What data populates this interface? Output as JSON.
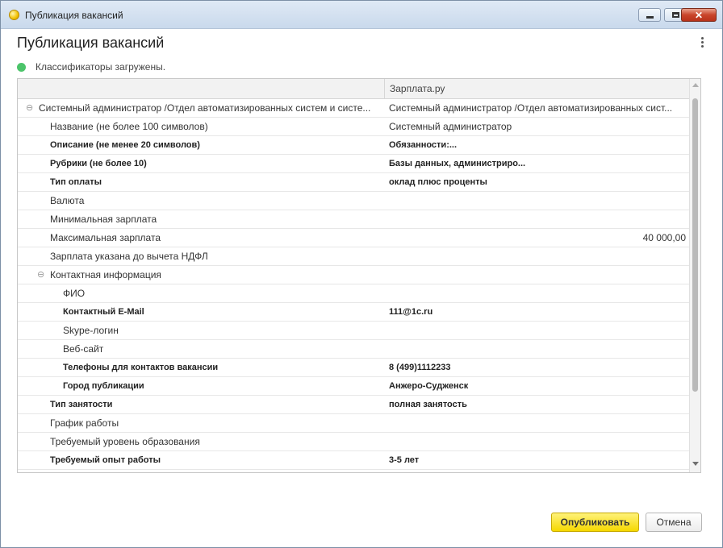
{
  "window": {
    "title": "Публикация вакансий"
  },
  "form": {
    "title": "Публикация вакансий",
    "status_text": "Классификаторы загружены.",
    "status_color": "#4cc46a"
  },
  "grid": {
    "header_col1": "",
    "header_col2": "Зарплата.ру",
    "rows": [
      {
        "label": "Системный администратор /Отдел автоматизированных систем и систе...",
        "value": "Системный администратор /Отдел автоматизированных сист...",
        "level": 0,
        "bold": false,
        "toggle": "⊖"
      },
      {
        "label": "Название (не более 100 символов)",
        "value": "Системный администратор",
        "level": 1,
        "bold": false
      },
      {
        "label": "Описание (не менее 20 символов)",
        "value": "Обязанности:...",
        "level": 1,
        "bold": true
      },
      {
        "label": "Рубрики (не более 10)",
        "value": "Базы данных, администриро...",
        "level": 1,
        "bold": true
      },
      {
        "label": "Тип оплаты",
        "value": "оклад плюс проценты",
        "level": 1,
        "bold": true
      },
      {
        "label": "Валюта",
        "value": "",
        "level": 1,
        "bold": false
      },
      {
        "label": "Минимальная зарплата",
        "value": "",
        "level": 1,
        "bold": false
      },
      {
        "label": "Максимальная зарплата",
        "value": "40 000,00",
        "level": 1,
        "bold": false,
        "numeric": true
      },
      {
        "label": "Зарплата указана до вычета НДФЛ",
        "value": "",
        "level": 1,
        "bold": false
      },
      {
        "label": "Контактная информация",
        "value": "",
        "level": 1,
        "bold": false,
        "toggle": "⊖"
      },
      {
        "label": "ФИО",
        "value": "",
        "level": 2,
        "bold": false
      },
      {
        "label": "Контактный E-Mail",
        "value": "111@1c.ru",
        "level": 2,
        "bold": true
      },
      {
        "label": "Skype-логин",
        "value": "",
        "level": 2,
        "bold": false
      },
      {
        "label": "Веб-сайт",
        "value": "",
        "level": 2,
        "bold": false
      },
      {
        "label": "Телефоны для контактов вакансии",
        "value": "8 (499)1112233",
        "level": 2,
        "bold": true
      },
      {
        "label": "Город публикации",
        "value": "Анжеро-Судженск",
        "level": 2,
        "bold": true
      },
      {
        "label": "Тип занятости",
        "value": "полная занятость",
        "level": 1,
        "bold": true
      },
      {
        "label": "График работы",
        "value": "",
        "level": 1,
        "bold": false
      },
      {
        "label": "Требуемый уровень образования",
        "value": "",
        "level": 1,
        "bold": false
      },
      {
        "label": "Требуемый опыт работы",
        "value": "3-5 лет",
        "level": 1,
        "bold": true
      }
    ]
  },
  "buttons": {
    "publish": "Опубликовать",
    "cancel": "Отмена"
  },
  "titlebar_buttons": {
    "close": "✕"
  }
}
